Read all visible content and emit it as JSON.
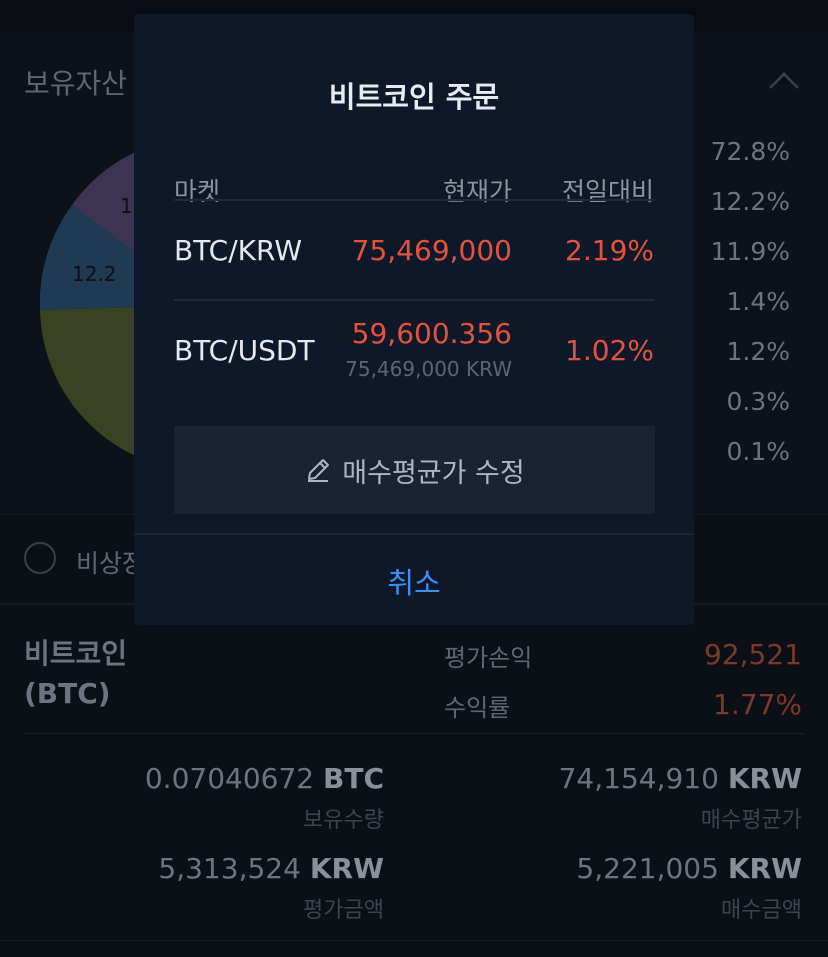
{
  "background": {
    "holdings_title": "보유자산",
    "pie_labels": [
      "1",
      "12.2"
    ],
    "percent_list": [
      "72.8%",
      "12.2%",
      "11.9%",
      "1.4%",
      "1.2%",
      "0.3%",
      "0.1%"
    ],
    "toggle_label": "비상장",
    "coin": {
      "name_line1": "비트코인",
      "name_line2": "(BTC)",
      "profit_label": "평가손익",
      "profit_value": "92,521",
      "return_label": "수익률",
      "return_value": "1.77%"
    },
    "stats": {
      "qty_value": "0.07040672",
      "qty_unit": "BTC",
      "qty_label": "보유수량",
      "avg_value": "74,154,910",
      "avg_unit": "KRW",
      "avg_label": "매수평균가",
      "eval_value": "5,313,524",
      "eval_unit": "KRW",
      "eval_label": "평가금액",
      "buy_value": "5,221,005",
      "buy_unit": "KRW",
      "buy_label": "매수금액"
    }
  },
  "modal": {
    "title": "비트코인 주문",
    "headers": {
      "market": "마켓",
      "price": "현재가",
      "change": "전일대비"
    },
    "rows": [
      {
        "market": "BTC/KRW",
        "price": "75,469,000",
        "price_sub": "",
        "change": "2.19%"
      },
      {
        "market": "BTC/USDT",
        "price": "59,600.356",
        "price_sub": "75,469,000 KRW",
        "change": "1.02%"
      }
    ],
    "edit_button": "매수평균가 수정",
    "cancel": "취소"
  },
  "colors": {
    "accent_up": "#e0533e",
    "link_blue": "#3f8ef3",
    "pie_purple": "#3d3452",
    "pie_blue": "#1f3a52",
    "pie_olive": "#3a4224"
  }
}
